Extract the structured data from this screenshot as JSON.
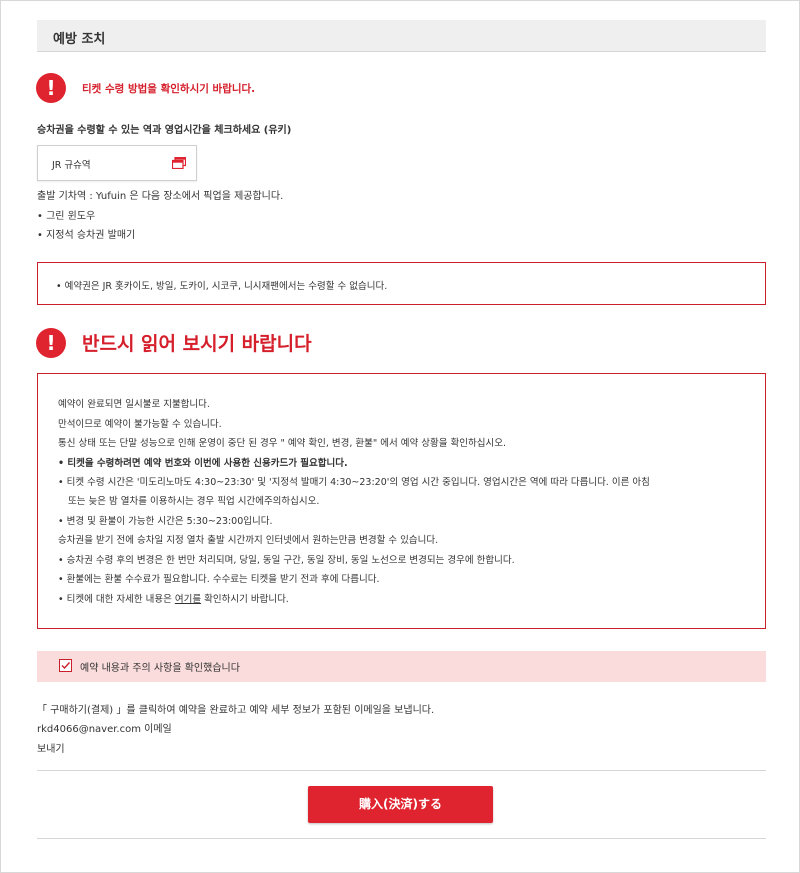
{
  "section": {
    "title": "예방 조치"
  },
  "alert_small": {
    "icon": "exclamation-icon",
    "text": "티켓 수령 방법을 확인하시기 바랍니다."
  },
  "pickup": {
    "heading": "승차권을 수령할 수 있는 역과 영업시간을 체크하세요 (유키)",
    "station_name": "JR 규슈역",
    "station_icon": "window-icon",
    "departure_line": "출발 기차역 : Yufuin 은 다음 장소에서 픽업을 제공합니다.",
    "locations": [
      "• 그린 윈도우",
      "• 지정석 승차권 발매기"
    ]
  },
  "notice_box": {
    "text": "• 예약권은 JR 홋카이도, 방일, 도카이, 시코쿠, 니시재팬에서는 수령할 수 없습니다."
  },
  "alert_big": {
    "icon": "exclamation-icon",
    "text": "반드시 읽어 보시기 바랍니다"
  },
  "info": {
    "lines": [
      "예약이 완료되면 일시불로 지불합니다.",
      "만석이므로 예약이 불가능할 수 있습니다.",
      "통신 상태 또는 단말 성능으로 인해 운영이 중단 된 경우 \" 예약 확인, 변경, 환불\" 에서 예약 상황을 확인하십시오.",
      "• 티켓을 수령하려면 예약 번호와 이번에 사용한 신용카드가 필요합니다.",
      "• 티켓 수령 시간은 '미도리노마도 4:30~23:30' 및 '지정석 발매기 4:30~23:20'의 영업 시간 중입니다. 영업시간은 역에 따라 다릅니다. 이른 아침",
      "또는 늦은 밤 열차를 이용하시는 경우 픽업 시간에주의하십시오.",
      "• 변경 및 환불이 가능한 시간은 5:30~23:00입니다.",
      "승차권을 받기 전에 승차일 지정 열차 출발 시간까지 인터넷에서 원하는만큼 변경할 수 있습니다.",
      "• 승차권 수령 후의 변경은 한 번만 처리되며, 당일, 동일 구간, 동일 장비, 동일 노선으로 변경되는 경우에 한합니다.",
      "• 환불에는 환불 수수료가 필요합니다. 수수료는 티켓을 받기 전과 후에 다릅니다.",
      "• 티켓에 대한 자세한 내용은",
      "여기를",
      "확인하시기 바랍니다."
    ]
  },
  "confirm": {
    "label": "예약 내용과 주의 사항을 확인했습니다",
    "checked": true
  },
  "footer": {
    "instruction": "「 구매하기(결제) 」를 클릭하여 예약을 완료하고 예약 세부 정보가 포함된 이메일을 보냅니다.",
    "email_line": "rkd4066@naver.com 이메일",
    "send_line": "보내기"
  },
  "buy_button": {
    "label": "購入(決済)する"
  },
  "colors": {
    "accent": "#e0242f",
    "confirm_bg": "#fbdcdc",
    "header_bg": "#efefef"
  }
}
